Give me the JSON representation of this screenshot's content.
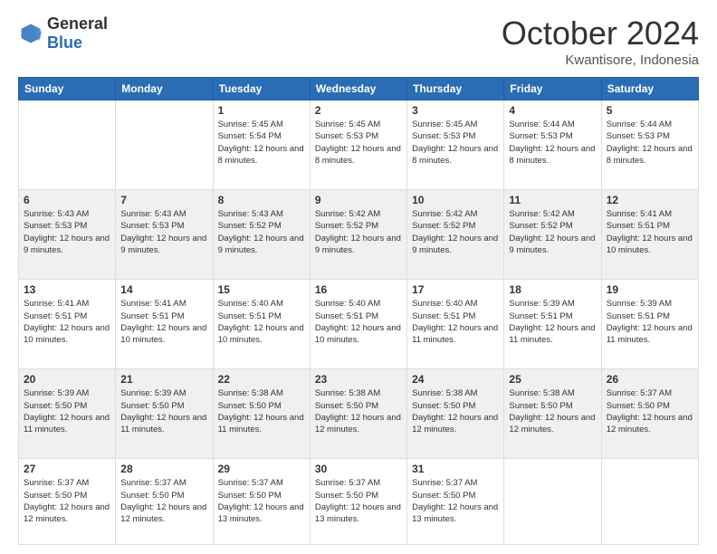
{
  "header": {
    "logo_general": "General",
    "logo_blue": "Blue",
    "month": "October 2024",
    "location": "Kwantisore, Indonesia"
  },
  "weekdays": [
    "Sunday",
    "Monday",
    "Tuesday",
    "Wednesday",
    "Thursday",
    "Friday",
    "Saturday"
  ],
  "weeks": [
    [
      {
        "day": "",
        "content": ""
      },
      {
        "day": "",
        "content": ""
      },
      {
        "day": "1",
        "content": "Sunrise: 5:45 AM\nSunset: 5:54 PM\nDaylight: 12 hours and 8 minutes."
      },
      {
        "day": "2",
        "content": "Sunrise: 5:45 AM\nSunset: 5:53 PM\nDaylight: 12 hours and 8 minutes."
      },
      {
        "day": "3",
        "content": "Sunrise: 5:45 AM\nSunset: 5:53 PM\nDaylight: 12 hours and 8 minutes."
      },
      {
        "day": "4",
        "content": "Sunrise: 5:44 AM\nSunset: 5:53 PM\nDaylight: 12 hours and 8 minutes."
      },
      {
        "day": "5",
        "content": "Sunrise: 5:44 AM\nSunset: 5:53 PM\nDaylight: 12 hours and 8 minutes."
      }
    ],
    [
      {
        "day": "6",
        "content": "Sunrise: 5:43 AM\nSunset: 5:53 PM\nDaylight: 12 hours and 9 minutes."
      },
      {
        "day": "7",
        "content": "Sunrise: 5:43 AM\nSunset: 5:53 PM\nDaylight: 12 hours and 9 minutes."
      },
      {
        "day": "8",
        "content": "Sunrise: 5:43 AM\nSunset: 5:52 PM\nDaylight: 12 hours and 9 minutes."
      },
      {
        "day": "9",
        "content": "Sunrise: 5:42 AM\nSunset: 5:52 PM\nDaylight: 12 hours and 9 minutes."
      },
      {
        "day": "10",
        "content": "Sunrise: 5:42 AM\nSunset: 5:52 PM\nDaylight: 12 hours and 9 minutes."
      },
      {
        "day": "11",
        "content": "Sunrise: 5:42 AM\nSunset: 5:52 PM\nDaylight: 12 hours and 9 minutes."
      },
      {
        "day": "12",
        "content": "Sunrise: 5:41 AM\nSunset: 5:51 PM\nDaylight: 12 hours and 10 minutes."
      }
    ],
    [
      {
        "day": "13",
        "content": "Sunrise: 5:41 AM\nSunset: 5:51 PM\nDaylight: 12 hours and 10 minutes."
      },
      {
        "day": "14",
        "content": "Sunrise: 5:41 AM\nSunset: 5:51 PM\nDaylight: 12 hours and 10 minutes."
      },
      {
        "day": "15",
        "content": "Sunrise: 5:40 AM\nSunset: 5:51 PM\nDaylight: 12 hours and 10 minutes."
      },
      {
        "day": "16",
        "content": "Sunrise: 5:40 AM\nSunset: 5:51 PM\nDaylight: 12 hours and 10 minutes."
      },
      {
        "day": "17",
        "content": "Sunrise: 5:40 AM\nSunset: 5:51 PM\nDaylight: 12 hours and 11 minutes."
      },
      {
        "day": "18",
        "content": "Sunrise: 5:39 AM\nSunset: 5:51 PM\nDaylight: 12 hours and 11 minutes."
      },
      {
        "day": "19",
        "content": "Sunrise: 5:39 AM\nSunset: 5:51 PM\nDaylight: 12 hours and 11 minutes."
      }
    ],
    [
      {
        "day": "20",
        "content": "Sunrise: 5:39 AM\nSunset: 5:50 PM\nDaylight: 12 hours and 11 minutes."
      },
      {
        "day": "21",
        "content": "Sunrise: 5:39 AM\nSunset: 5:50 PM\nDaylight: 12 hours and 11 minutes."
      },
      {
        "day": "22",
        "content": "Sunrise: 5:38 AM\nSunset: 5:50 PM\nDaylight: 12 hours and 11 minutes."
      },
      {
        "day": "23",
        "content": "Sunrise: 5:38 AM\nSunset: 5:50 PM\nDaylight: 12 hours and 12 minutes."
      },
      {
        "day": "24",
        "content": "Sunrise: 5:38 AM\nSunset: 5:50 PM\nDaylight: 12 hours and 12 minutes."
      },
      {
        "day": "25",
        "content": "Sunrise: 5:38 AM\nSunset: 5:50 PM\nDaylight: 12 hours and 12 minutes."
      },
      {
        "day": "26",
        "content": "Sunrise: 5:37 AM\nSunset: 5:50 PM\nDaylight: 12 hours and 12 minutes."
      }
    ],
    [
      {
        "day": "27",
        "content": "Sunrise: 5:37 AM\nSunset: 5:50 PM\nDaylight: 12 hours and 12 minutes."
      },
      {
        "day": "28",
        "content": "Sunrise: 5:37 AM\nSunset: 5:50 PM\nDaylight: 12 hours and 12 minutes."
      },
      {
        "day": "29",
        "content": "Sunrise: 5:37 AM\nSunset: 5:50 PM\nDaylight: 12 hours and 13 minutes."
      },
      {
        "day": "30",
        "content": "Sunrise: 5:37 AM\nSunset: 5:50 PM\nDaylight: 12 hours and 13 minutes."
      },
      {
        "day": "31",
        "content": "Sunrise: 5:37 AM\nSunset: 5:50 PM\nDaylight: 12 hours and 13 minutes."
      },
      {
        "day": "",
        "content": ""
      },
      {
        "day": "",
        "content": ""
      }
    ]
  ]
}
